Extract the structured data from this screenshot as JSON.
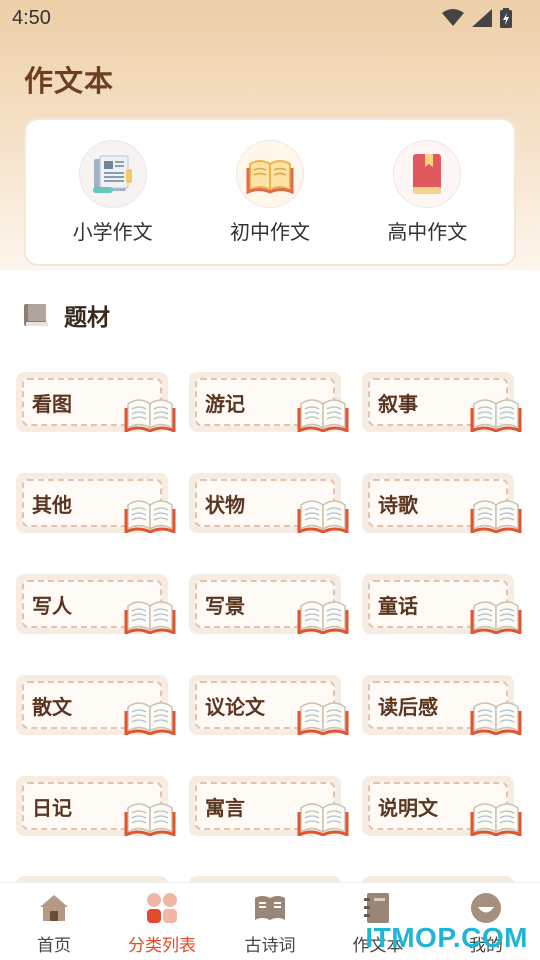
{
  "status_bar": {
    "time": "4:50"
  },
  "page": {
    "title": "作文本"
  },
  "levels": [
    {
      "label": "小学作文",
      "icon": "newspaper-icon"
    },
    {
      "label": "初中作文",
      "icon": "open-book-icon"
    },
    {
      "label": "高中作文",
      "icon": "red-book-icon"
    }
  ],
  "section": {
    "title": "题材",
    "icon": "book-stack-icon"
  },
  "topics": [
    "看图",
    "游记",
    "叙事",
    "其他",
    "状物",
    "诗歌",
    "写人",
    "写景",
    "童话",
    "散文",
    "议论文",
    "读后感",
    "日记",
    "寓言",
    "说明文"
  ],
  "nav": [
    {
      "label": "首页",
      "icon": "home-icon",
      "active": false
    },
    {
      "label": "分类列表",
      "icon": "category-icon",
      "active": true
    },
    {
      "label": "古诗词",
      "icon": "poetry-book-icon",
      "active": false
    },
    {
      "label": "作文本",
      "icon": "notebook-icon",
      "active": false
    },
    {
      "label": "我的",
      "icon": "profile-icon",
      "active": false
    }
  ],
  "watermark": "ITMOP.COM",
  "colors": {
    "accent": "#e04b2b",
    "title": "#6b3f1f",
    "card_bg": "#f7ece2"
  }
}
